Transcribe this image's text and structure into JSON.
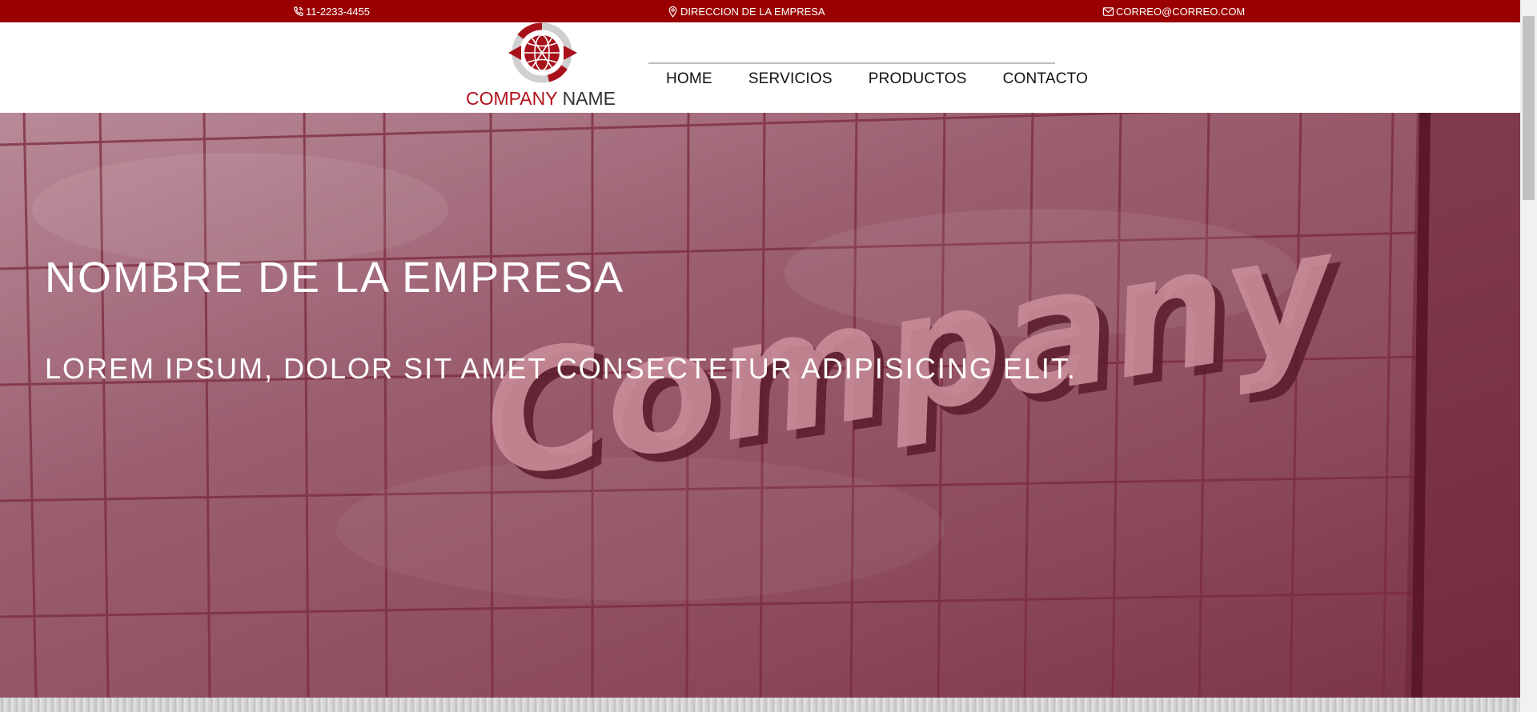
{
  "topbar": {
    "phone": "11-2233-4455",
    "phone_icon": "phone-icon",
    "address": "DIRECCION DE LA EMPRESA",
    "address_icon": "map-pin-icon",
    "email": "CORREO@CORREO.COM",
    "email_icon": "envelope-icon",
    "background": "#9a0000"
  },
  "logo": {
    "word1": "COMPANY",
    "word2": "NAME",
    "icon": "globe-logo-icon",
    "accent": "#b0121b"
  },
  "nav": {
    "items": [
      {
        "label": "HOME"
      },
      {
        "label": "SERVICIOS"
      },
      {
        "label": "PRODUCTOS"
      },
      {
        "label": "CONTACTO"
      }
    ]
  },
  "hero": {
    "title": "NOMBRE DE LA EMPRESA",
    "subtitle": "LOREM IPSUM, DOLOR SIT AMET CONSECTETUR ADIPISICING ELIT.",
    "overlay_color": "#9b5f70"
  }
}
